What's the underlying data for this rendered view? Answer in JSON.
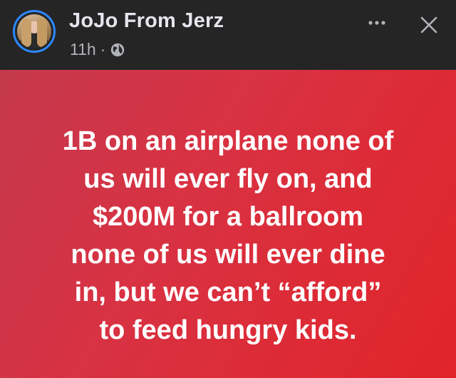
{
  "post": {
    "author": "JoJo From Jerz",
    "time": "11h",
    "separator": "·",
    "privacy_icon": "globe-icon",
    "lines": [
      "1B on an airplane none of",
      "us will ever fly on, and",
      "$200M for a ballroom",
      "none of us will ever dine",
      "in, but we can’t “afford”",
      "to feed hungry kids."
    ]
  },
  "icons": {
    "more": "more-options-icon",
    "close": "close-icon",
    "avatar": "avatar"
  },
  "colors": {
    "header_bg": "#252526",
    "avatar_ring": "#2d88ff",
    "post_bg_start": "#c5384c",
    "post_bg_end": "#e1242a",
    "text": "#ffffff",
    "muted_text": "#b0b3b8"
  }
}
